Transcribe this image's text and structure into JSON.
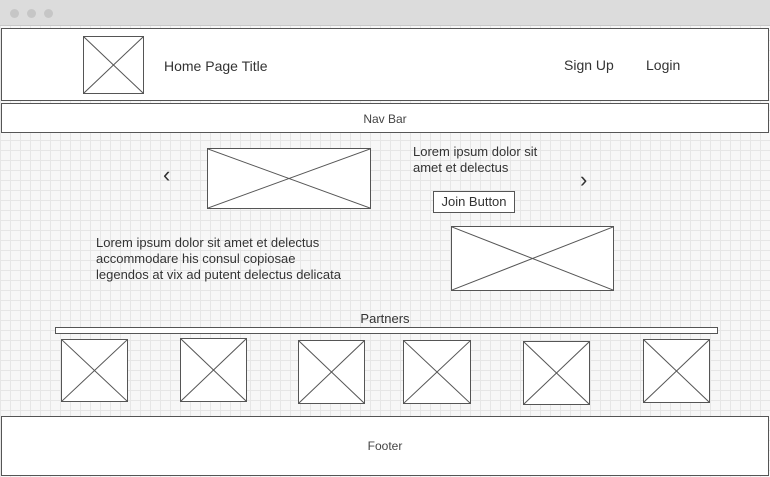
{
  "header": {
    "title": "Home Page Title",
    "signup_label": "Sign Up",
    "login_label": "Login",
    "logo_icon": "image-placeholder-icon"
  },
  "nav": {
    "label": "Nav Bar"
  },
  "hero": {
    "prev_icon": "chevron-left-icon",
    "next_icon": "chevron-right-icon",
    "text_line1": "Lorem ipsum dolor sit",
    "text_line2": "amet et delectus",
    "join_label": "Join Button"
  },
  "intro": {
    "line1": "Lorem ipsum dolor sit amet et delectus",
    "line2": "accommodare his consul copiosae",
    "line3": "legendos at vix ad putent delectus delicata"
  },
  "partners": {
    "label": "Partners",
    "count": 6
  },
  "footer": {
    "label": "Footer"
  }
}
